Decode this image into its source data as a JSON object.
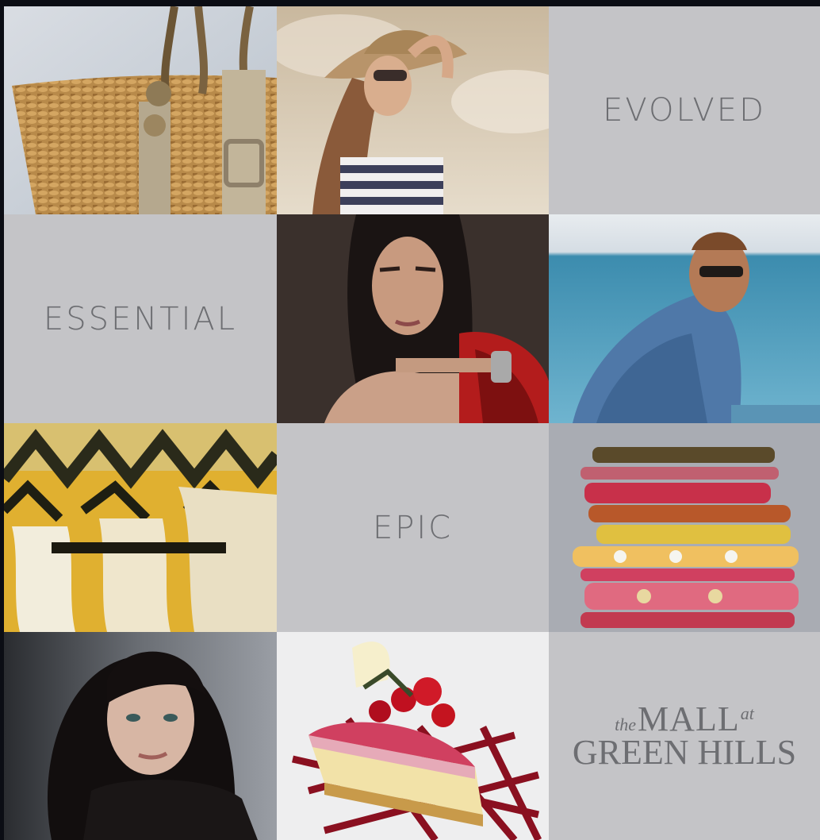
{
  "tiles": {
    "evolved": "EVOLVED",
    "essential": "ESSENTIAL",
    "epic": "EPIC"
  },
  "logo": {
    "the": "the",
    "mall": "MALL",
    "at": "at",
    "green_hills": "GREEN HILLS"
  },
  "colors": {
    "tile_background": "#c4c4c7",
    "tile_text": "#6d6e72",
    "page_background": "#0b0d14"
  }
}
